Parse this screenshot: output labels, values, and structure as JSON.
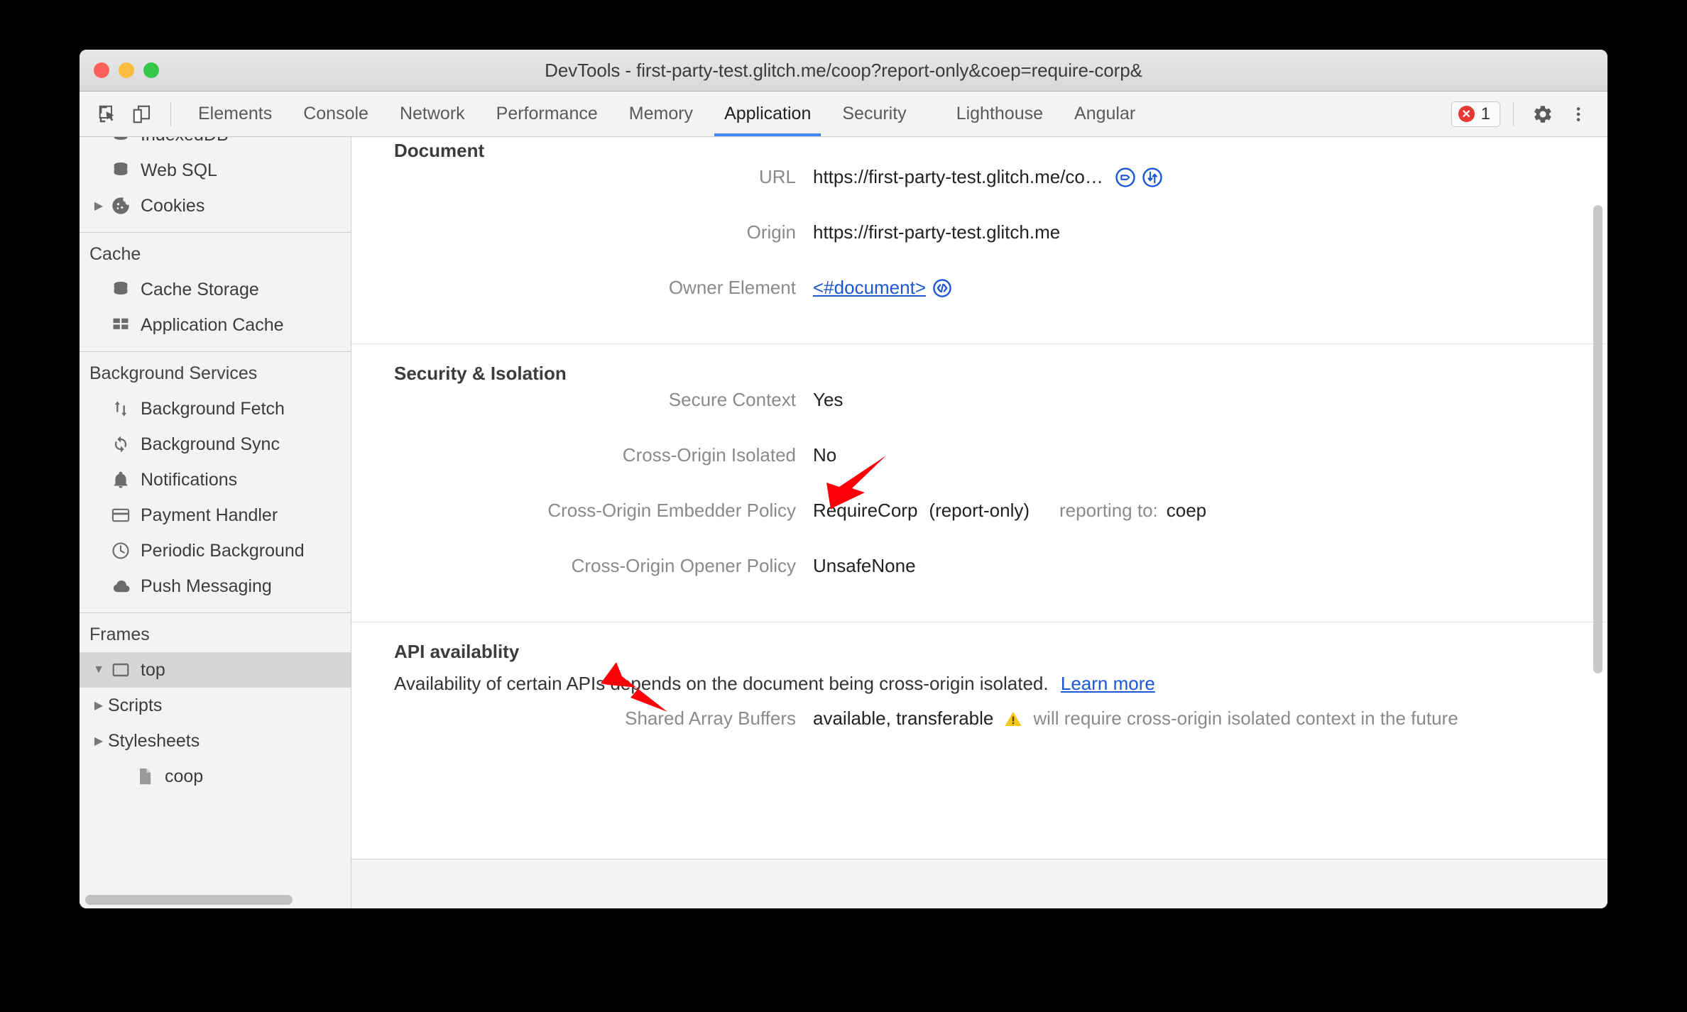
{
  "window": {
    "title": "DevTools - first-party-test.glitch.me/coop?report-only&coep=require-corp&",
    "traffic_lights": [
      "close",
      "minimize",
      "zoom"
    ]
  },
  "toolbar": {
    "inspect_icon": "inspect-element-icon",
    "device_icon": "device-toolbar-icon",
    "tabs": [
      {
        "label": "Elements",
        "active": false
      },
      {
        "label": "Console",
        "active": false
      },
      {
        "label": "Network",
        "active": false
      },
      {
        "label": "Performance",
        "active": false
      },
      {
        "label": "Memory",
        "active": false
      },
      {
        "label": "Application",
        "active": true
      },
      {
        "label": "Security",
        "active": false
      },
      {
        "label": "Lighthouse",
        "active": false
      },
      {
        "label": "Angular",
        "active": false
      }
    ],
    "error_count": "1",
    "error_icon": "error-circle-icon",
    "settings_icon": "gear-icon",
    "more_icon": "kebab-menu-icon",
    "active_tab_underline_color": "#4285f4"
  },
  "sidebar": {
    "groups": [
      {
        "title": "",
        "items": [
          {
            "label": "IndexedDB",
            "icon": "database-icon",
            "arrow": "",
            "clipped": true
          },
          {
            "label": "Web SQL",
            "icon": "database-icon",
            "arrow": ""
          },
          {
            "label": "Cookies",
            "icon": "cookie-icon",
            "arrow": "▶"
          }
        ]
      },
      {
        "title": "Cache",
        "items": [
          {
            "label": "Cache Storage",
            "icon": "database-icon",
            "arrow": ""
          },
          {
            "label": "Application Cache",
            "icon": "grid-icon",
            "arrow": ""
          }
        ]
      },
      {
        "title": "Background Services",
        "items": [
          {
            "label": "Background Fetch",
            "icon": "up-down-arrows-icon",
            "arrow": ""
          },
          {
            "label": "Background Sync",
            "icon": "sync-icon",
            "arrow": ""
          },
          {
            "label": "Notifications",
            "icon": "bell-icon",
            "arrow": ""
          },
          {
            "label": "Payment Handler",
            "icon": "credit-card-icon",
            "arrow": ""
          },
          {
            "label": "Periodic Background",
            "icon": "clock-icon",
            "arrow": ""
          },
          {
            "label": "Push Messaging",
            "icon": "cloud-icon",
            "arrow": ""
          }
        ]
      },
      {
        "title": "Frames",
        "items": [
          {
            "label": "top",
            "icon": "frame-icon",
            "arrow": "▼",
            "selected": true
          },
          {
            "label": "Scripts",
            "icon": "",
            "arrow": "▶"
          },
          {
            "label": "Stylesheets",
            "icon": "",
            "arrow": "▶"
          },
          {
            "label": "coop",
            "icon": "document-icon",
            "arrow": ""
          }
        ]
      }
    ],
    "selected_background": "#d6d6d6"
  },
  "main": {
    "document_section": {
      "title": "Document",
      "rows": [
        {
          "label": "URL",
          "value": "https://first-party-test.glitch.me/co…",
          "icons": [
            "open-network-panel-icon",
            "open-sources-panel-icon"
          ]
        },
        {
          "label": "Origin",
          "value": "https://first-party-test.glitch.me",
          "icons": []
        },
        {
          "label": "Owner Element",
          "value": "<#document>",
          "link": true,
          "icons": [
            "reveal-in-elements-icon"
          ]
        }
      ]
    },
    "security_section": {
      "title": "Security & Isolation",
      "rows": [
        {
          "label": "Secure Context",
          "value": "Yes",
          "extra": "",
          "extra2": ""
        },
        {
          "label": "Cross-Origin Isolated",
          "value": "No",
          "extra": "",
          "extra2": ""
        },
        {
          "label": "Cross-Origin Embedder Policy",
          "value": "RequireCorp",
          "extra": "(report-only)",
          "extra2": "reporting to:",
          "extra3": "coep"
        },
        {
          "label": "Cross-Origin Opener Policy",
          "value": "UnsafeNone",
          "extra": "",
          "extra2": ""
        }
      ]
    },
    "api_section": {
      "title": "API availablity",
      "description_prefix": "Availability of certain APIs depends on the document being cross-origin isolated.",
      "learn_more": "Learn more",
      "rows": [
        {
          "label": "Shared Array Buffers",
          "value": "available, transferable",
          "warning_icon": "warning-triangle-icon",
          "note": "will require cross-origin isolated context in the future"
        }
      ]
    }
  },
  "annotations": [
    {
      "name": "arrow-to-cross-origin-isolated",
      "color": "#fb0007"
    },
    {
      "name": "arrow-to-api-availablity",
      "color": "#fb0007"
    }
  ],
  "colors": {
    "accent": "#4285f4",
    "link": "#1a56d6",
    "icon_blue": "#1a56d6",
    "error_red": "#e53935",
    "annotation_red": "#fb0007",
    "warning_yellow": "#f5c518"
  }
}
